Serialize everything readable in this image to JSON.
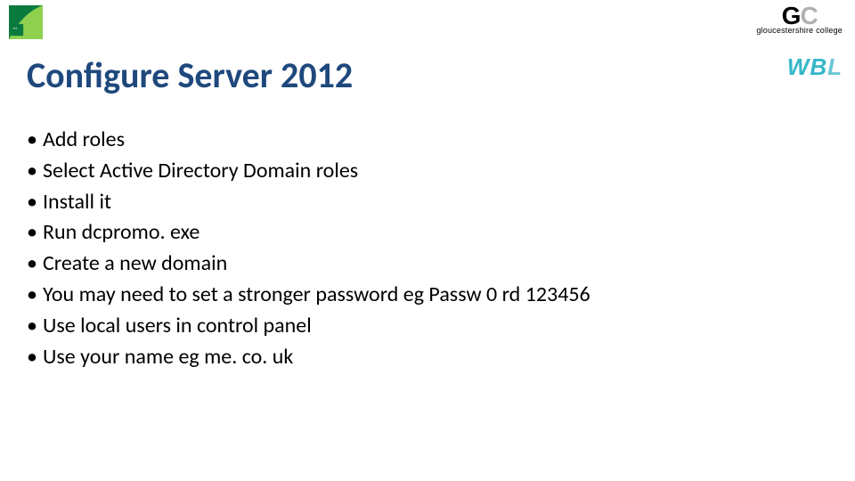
{
  "title": "Configure Server 2012",
  "bullets": [
    "Add roles",
    "Select Active Directory Domain roles",
    "Install it",
    "Run dcpromo. exe",
    "Create a new domain",
    "You may need to set a stronger password eg Passw 0 rd 123456",
    "Use local users in control panel",
    "Use your name eg me. co. uk"
  ],
  "logos": {
    "bcs_alt": "BCS logo",
    "gc_text": "GC",
    "gc_sub": "gloucestershire college",
    "wbl_text": "WBL"
  }
}
